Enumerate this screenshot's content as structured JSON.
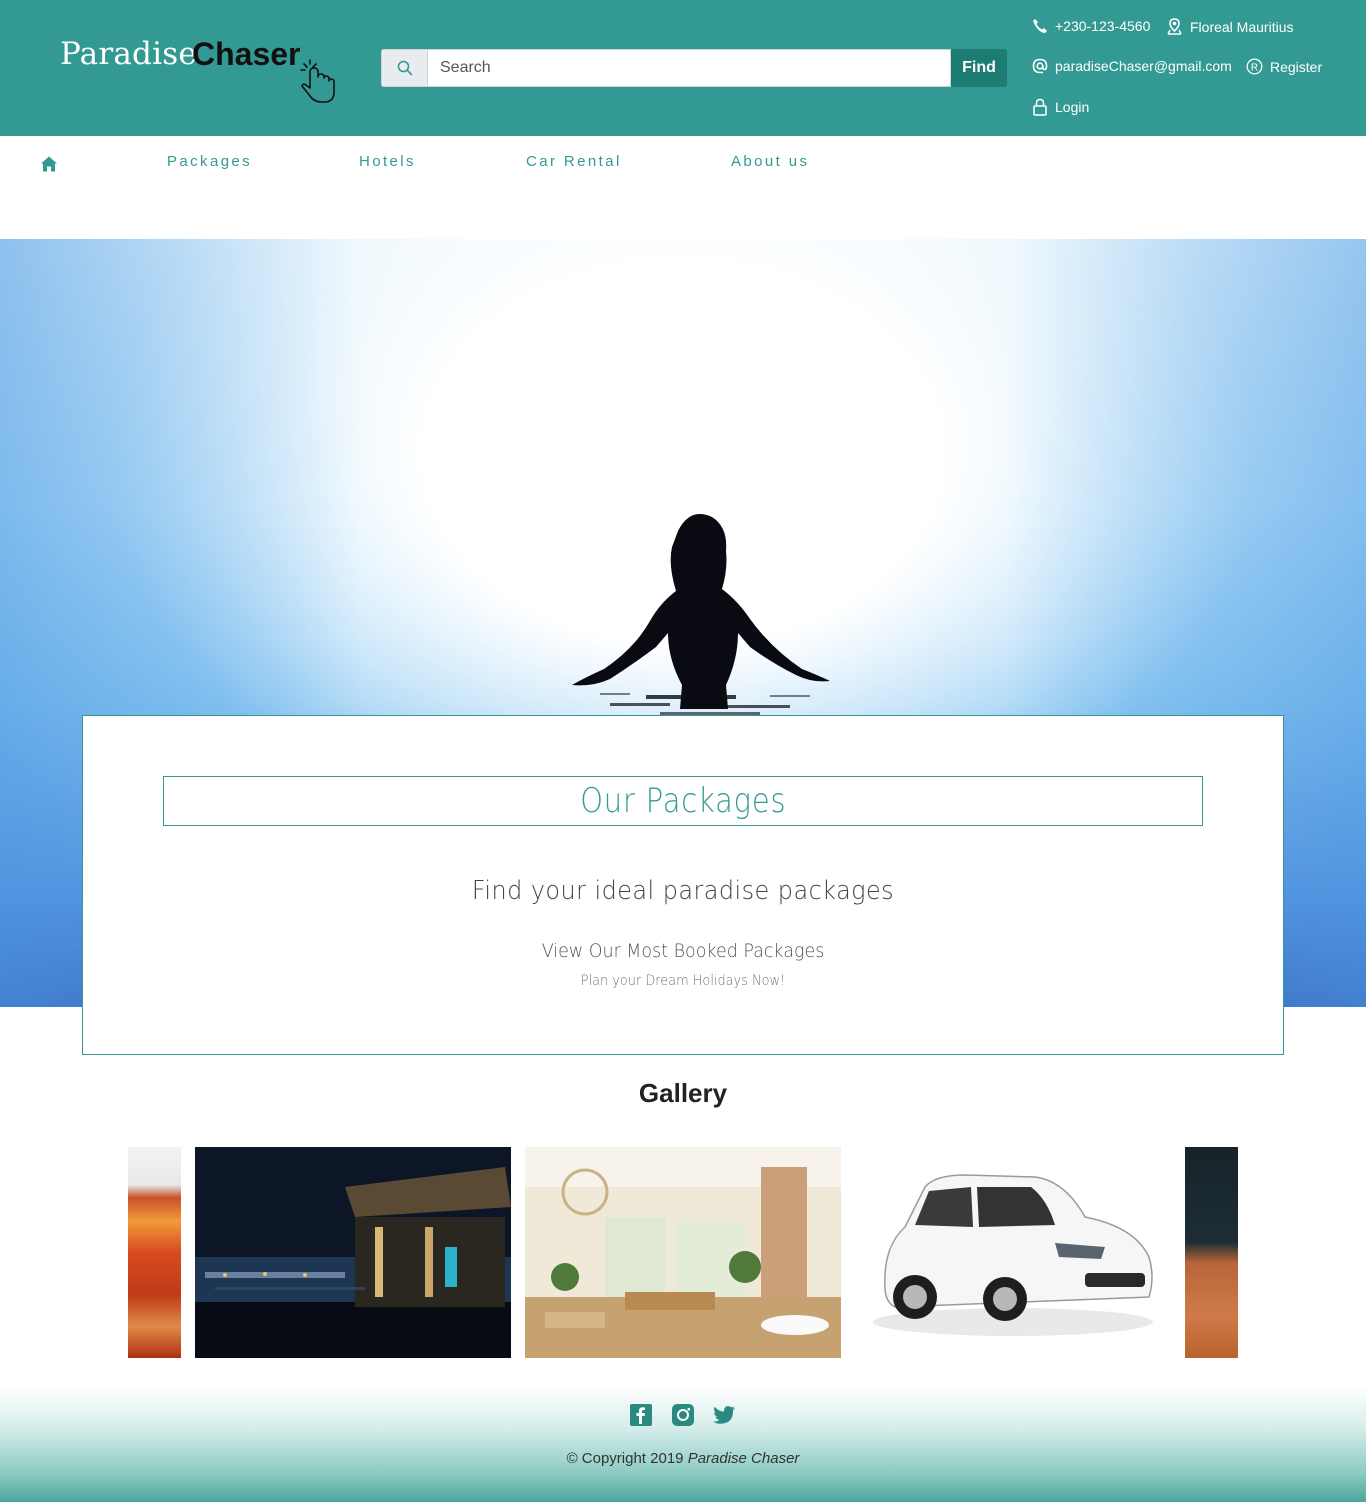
{
  "header": {
    "logo": {
      "part1": "Paradise",
      "part2": "Chaser"
    },
    "search": {
      "placeholder": "Search",
      "button_label": "Find"
    },
    "contacts": {
      "phone": "+230-123-4560",
      "location": "Floreal Mauritius",
      "email": "paradiseChaser@gmail.com",
      "register": "Register",
      "login": "Login"
    },
    "background_color": "#339a93"
  },
  "nav": {
    "home_icon": "home-icon",
    "items": [
      {
        "label": "Packages"
      },
      {
        "label": "Hotels"
      },
      {
        "label": "Car Rental"
      },
      {
        "label": "About us"
      }
    ]
  },
  "packages": {
    "title": "Our Packages",
    "subtitle": "Find your ideal paradise packages",
    "link": "View Our Most Booked Packages",
    "note": "Plan your Dream Holidays Now!"
  },
  "gallery": {
    "title": "Gallery",
    "images": [
      {
        "name": "restaurant-interior-image"
      },
      {
        "name": "night-resort-image"
      },
      {
        "name": "dining-hall-image"
      },
      {
        "name": "white-car-image"
      },
      {
        "name": "signage-image"
      }
    ]
  },
  "footer": {
    "social": [
      "facebook-icon",
      "instagram-icon",
      "twitter-icon"
    ],
    "copyright_prefix": "© Copyright 2019",
    "copyright_brand": "Paradise Chaser"
  },
  "colors": {
    "accent": "#339a93",
    "button": "#1d7c72"
  }
}
